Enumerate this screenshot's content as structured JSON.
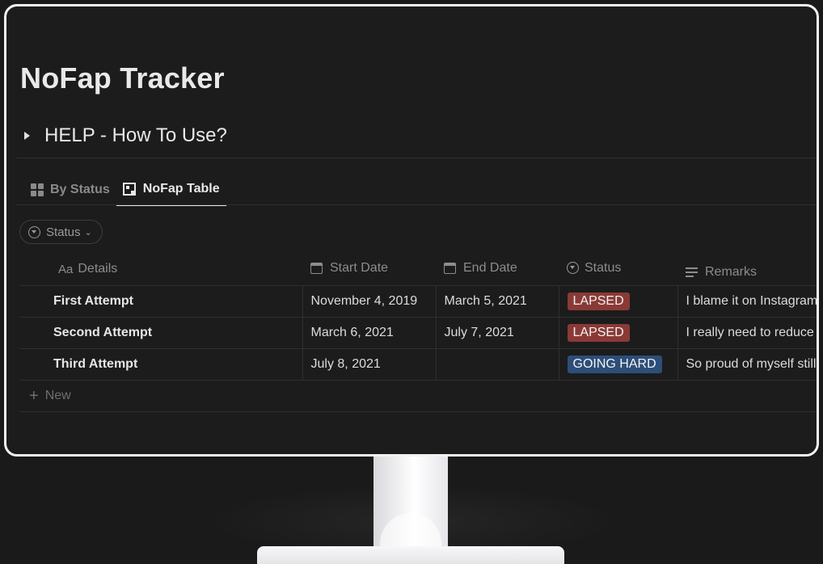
{
  "page": {
    "title": "NoFap Tracker"
  },
  "toggle": {
    "label": "HELP - How To Use?"
  },
  "views": [
    {
      "label": "By Status",
      "icon": "board-icon",
      "active": false
    },
    {
      "label": "NoFap Table",
      "icon": "table-icon",
      "active": true
    }
  ],
  "filter": {
    "label": "Status"
  },
  "table": {
    "columns": [
      "Details",
      "Start Date",
      "End Date",
      "Status",
      "Remarks"
    ],
    "rows": [
      {
        "details": "First Attempt",
        "start": "November 4, 2019",
        "end": "March 5, 2021",
        "status": "LAPSED",
        "remarks": "I blame it on Instagram"
      },
      {
        "details": "Second Attempt",
        "start": "March 6, 2021",
        "end": "July 7, 2021",
        "status": "LAPSED",
        "remarks": "I really need to reduce"
      },
      {
        "details": "Third Attempt",
        "start": "July 8, 2021",
        "end": "",
        "status": "GOING HARD",
        "remarks": "So proud of myself still"
      }
    ],
    "new_label": "New"
  },
  "colors": {
    "lapsed": "#8a3a36",
    "going_hard": "#2d4e78",
    "background": "#191919"
  }
}
